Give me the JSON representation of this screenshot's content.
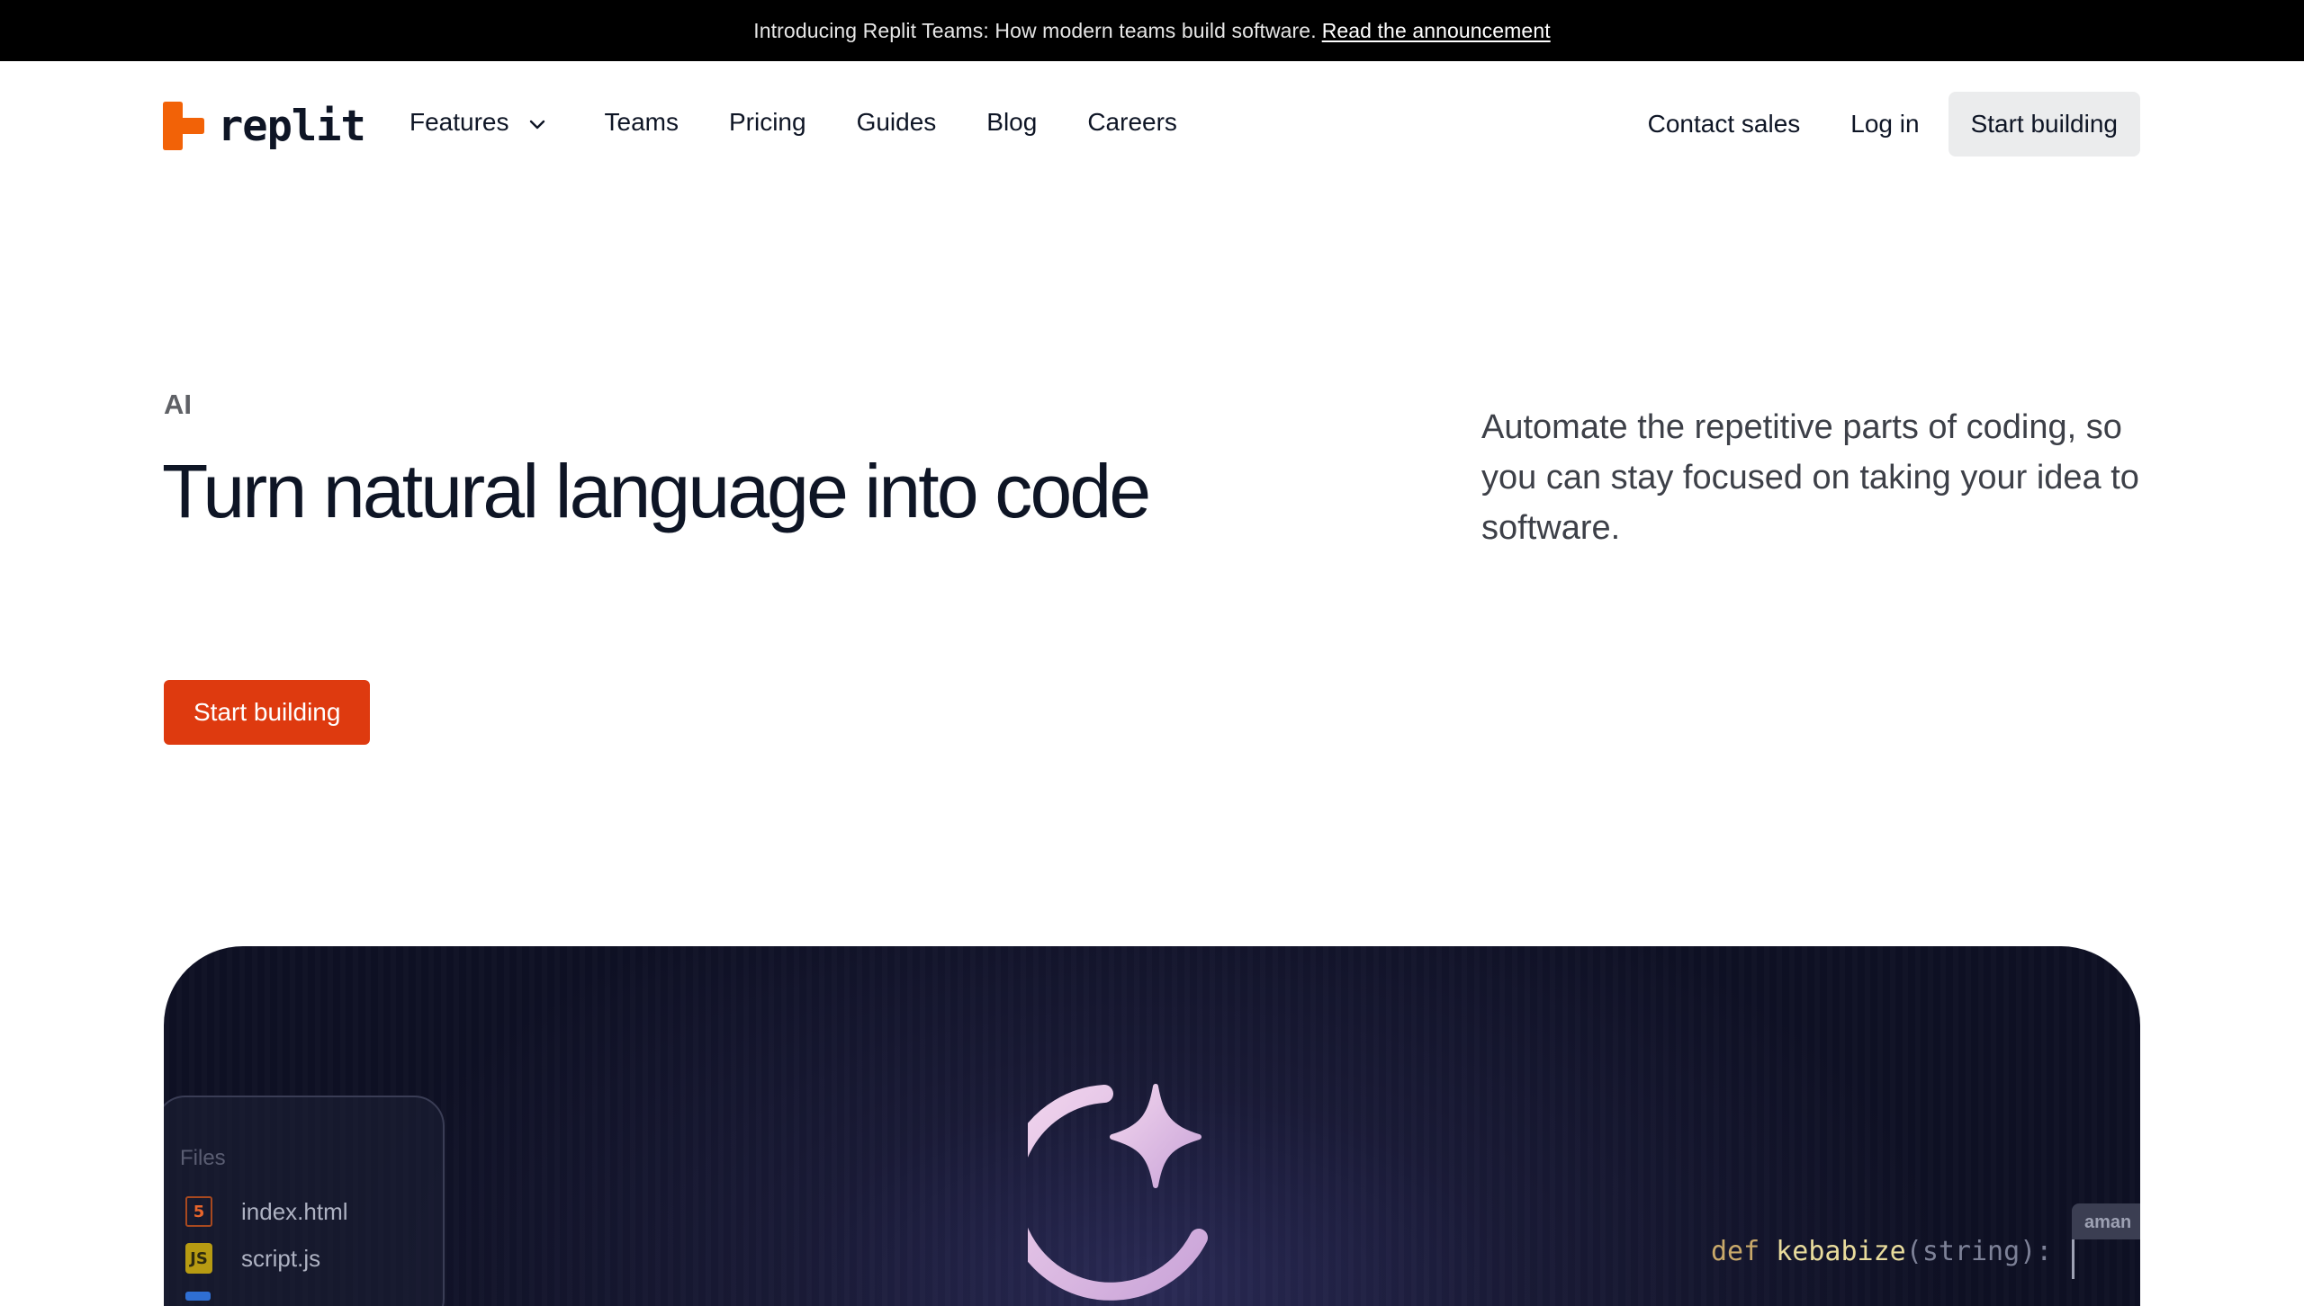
{
  "announcement": {
    "text": "Introducing Replit Teams: How modern teams build software.",
    "link": "Read the announcement"
  },
  "nav": {
    "logo_text": "replit",
    "items": [
      "Features",
      "Teams",
      "Pricing",
      "Guides",
      "Blog",
      "Careers"
    ],
    "contact": "Contact sales",
    "login": "Log in",
    "cta": "Start building"
  },
  "hero": {
    "eyebrow": "AI",
    "headline": "Turn natural language into code",
    "cta": "Start building",
    "lede": "Automate the repetitive parts of coding, so you can stay focused on taking your idea to software."
  },
  "showcase": {
    "files_title": "Files",
    "files": [
      {
        "name": "index.html",
        "icon": "html5-icon"
      },
      {
        "name": "script.js",
        "icon": "js-icon",
        "badge": "JS"
      }
    ],
    "code": {
      "keyword": "def",
      "name": "kebabize",
      "open": "(",
      "arg": "string",
      "close": "):"
    },
    "cursor_user": "aman"
  },
  "colors": {
    "brand": "#de3a0f",
    "announcement_bg": "#000000",
    "panel_bg": "#191a36",
    "ai_mark": "#e6c4e6"
  }
}
